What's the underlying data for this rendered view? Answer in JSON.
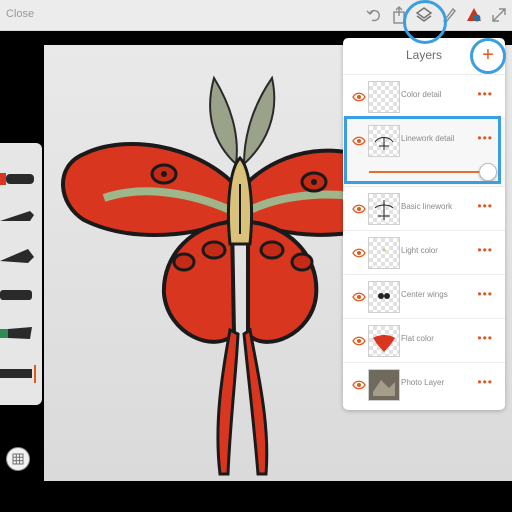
{
  "topbar": {
    "close_label": "Close",
    "icons": [
      "undo-icon",
      "share-icon",
      "layers-icon",
      "brush-icon",
      "color-icon",
      "fullscreen-icon"
    ]
  },
  "layers_panel": {
    "title": "Layers",
    "add_icon": "plus-icon",
    "more_label": "•••",
    "layers": [
      {
        "name": "Color detail",
        "visible": true
      },
      {
        "name": "Linework detail",
        "visible": true,
        "selected": true,
        "opacity": 1.0
      },
      {
        "name": "Basic linework",
        "visible": true
      },
      {
        "name": "Light color",
        "visible": true
      },
      {
        "name": "Center wings",
        "visible": true
      },
      {
        "name": "Flat color",
        "visible": true
      },
      {
        "name": "Photo Layer",
        "visible": true
      }
    ]
  },
  "colors": {
    "accent": "#e05a1e",
    "highlight": "#3a9fe0",
    "moth_red": "#d9361f",
    "moth_green": "#9fb58a",
    "moth_tan": "#d9c37a"
  }
}
